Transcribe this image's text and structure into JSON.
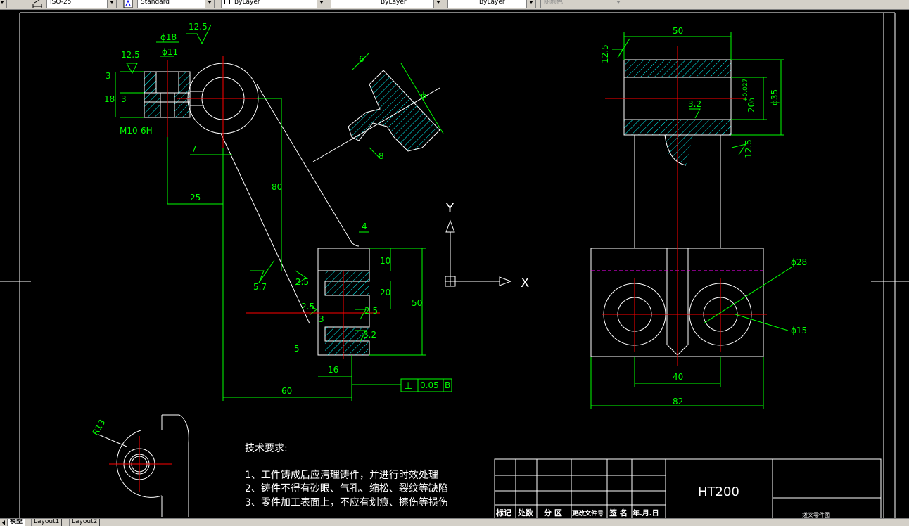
{
  "toolbar": {
    "dimstyle_value": "ISO-25",
    "textstyle_value": "Standard",
    "layer_value": "ByLayer",
    "linetype_value": "ByLayer",
    "lineweight_value": "ByLayer",
    "plotstyle_value": "随颜色"
  },
  "colors": {
    "background": "#000000",
    "geometry": "#ffffff",
    "dimensions": "#00ff00",
    "centerlines": "#ff0000",
    "hatch": "#00ffff",
    "hidden_line": "#ff00ff"
  },
  "drawing": {
    "ucs_x_label": "X",
    "ucs_y_label": "Y",
    "left_view": {
      "dim_phi18": "ϕ18",
      "dim_phi11": "ϕ11",
      "rough_12_5_top": "12.5",
      "rough_12_5_left": "12.5",
      "dim_3_top": "3",
      "dim_18": "18",
      "dim_3_bottom": "3",
      "thread": "M10-6H",
      "dim_7": "7",
      "dim_25": "25",
      "dim_80": "80",
      "dim_60": "60",
      "dim_4": "4",
      "dim_10": "10",
      "dim_20": "20",
      "dim_50": "50",
      "dim_16": "16",
      "dim_3_web": "3",
      "dim_5": "5",
      "rough_5_7": "5.7",
      "rough_2_5_a": "2.5",
      "rough_2_5_b": "2.5",
      "rough_2_5_c": "2.5",
      "rough_3_2": "3.2",
      "tolerance_symbol": "⊥",
      "tolerance_value": "0.05",
      "tolerance_datum": "B"
    },
    "section_view": {
      "dim_6": "6",
      "dim_8": "8",
      "dim_phi": "ϕ"
    },
    "right_view": {
      "dim_50": "50",
      "rough_12_5_top": "12.5",
      "rough_12_5_side": "12.5",
      "rough_3_2": "3.2",
      "dim_20": "20",
      "tol_upper": "+0.027",
      "tol_lower": "0",
      "dim_phi35": "ϕ35",
      "dim_phi28": "ϕ28",
      "dim_phi15": "ϕ15",
      "dim_40": "40",
      "dim_82": "82"
    },
    "detail_view": {
      "radius": "R13"
    }
  },
  "notes": {
    "title": "技术要求:",
    "items": [
      "1、工件铸成后应清理铸件，并进行时效处理",
      "2、铸件不得有砂眼、气孔、缩松、裂纹等缺陷",
      "3、零件加工表面上，不应有划痕、擦伤等损伤"
    ]
  },
  "title_block": {
    "material": "HT200",
    "headers": [
      "标记",
      "处数",
      "分 区",
      "更改文件号",
      "签 名",
      "年.月.日"
    ],
    "drawing_name": "拨叉零件图"
  },
  "tabs": [
    "模型",
    "Layout1",
    "Layout2"
  ]
}
